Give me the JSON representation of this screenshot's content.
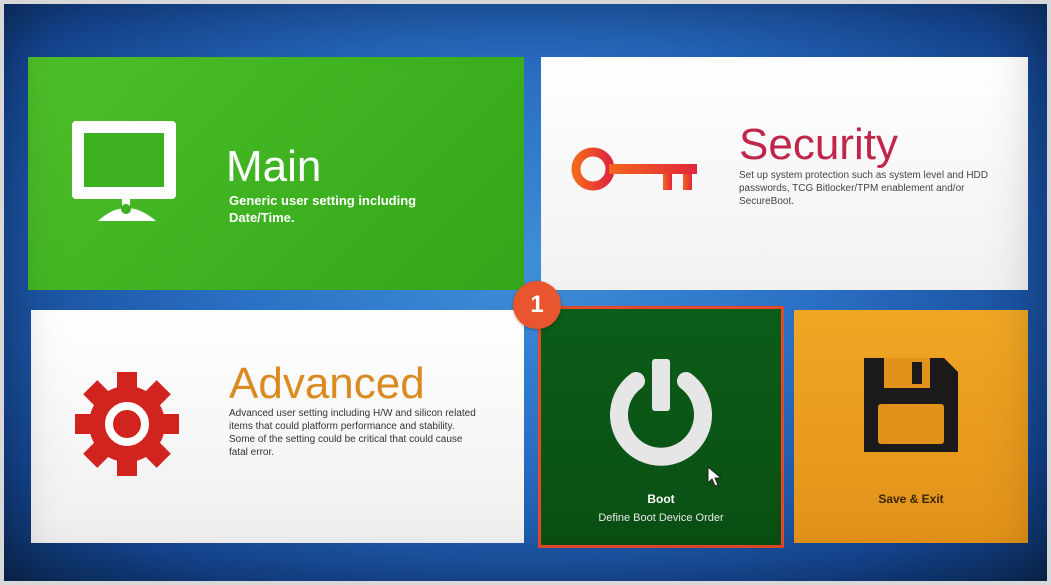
{
  "tiles": {
    "main": {
      "title": "Main",
      "description": "Generic user setting including Date/Time.",
      "color": "#3cb01f",
      "icon": "monitor-icon"
    },
    "security": {
      "title": "Security",
      "description": "Set up system protection such as system level and HDD passwords, TCG Bitlocker/TPM enablement and/or SecureBoot.",
      "color": "#c0264a",
      "icon": "key-icon"
    },
    "advanced": {
      "title": "Advanced",
      "description": "Advanced user setting including H/W and silicon related items that could platform performance and stability. Some of the setting could be critical that could cause fatal error.",
      "color": "#d98b22",
      "icon": "gear-icon"
    },
    "boot": {
      "title": "Boot",
      "subtitle": "Define Boot Device Order",
      "color": "#0a5a17",
      "icon": "power-icon",
      "highlighted": true
    },
    "save_exit": {
      "title": "Save & Exit",
      "color": "#eb9e20",
      "icon": "floppy-disk-icon"
    }
  },
  "annotation": {
    "step_number": "1",
    "color": "#e8552e"
  }
}
